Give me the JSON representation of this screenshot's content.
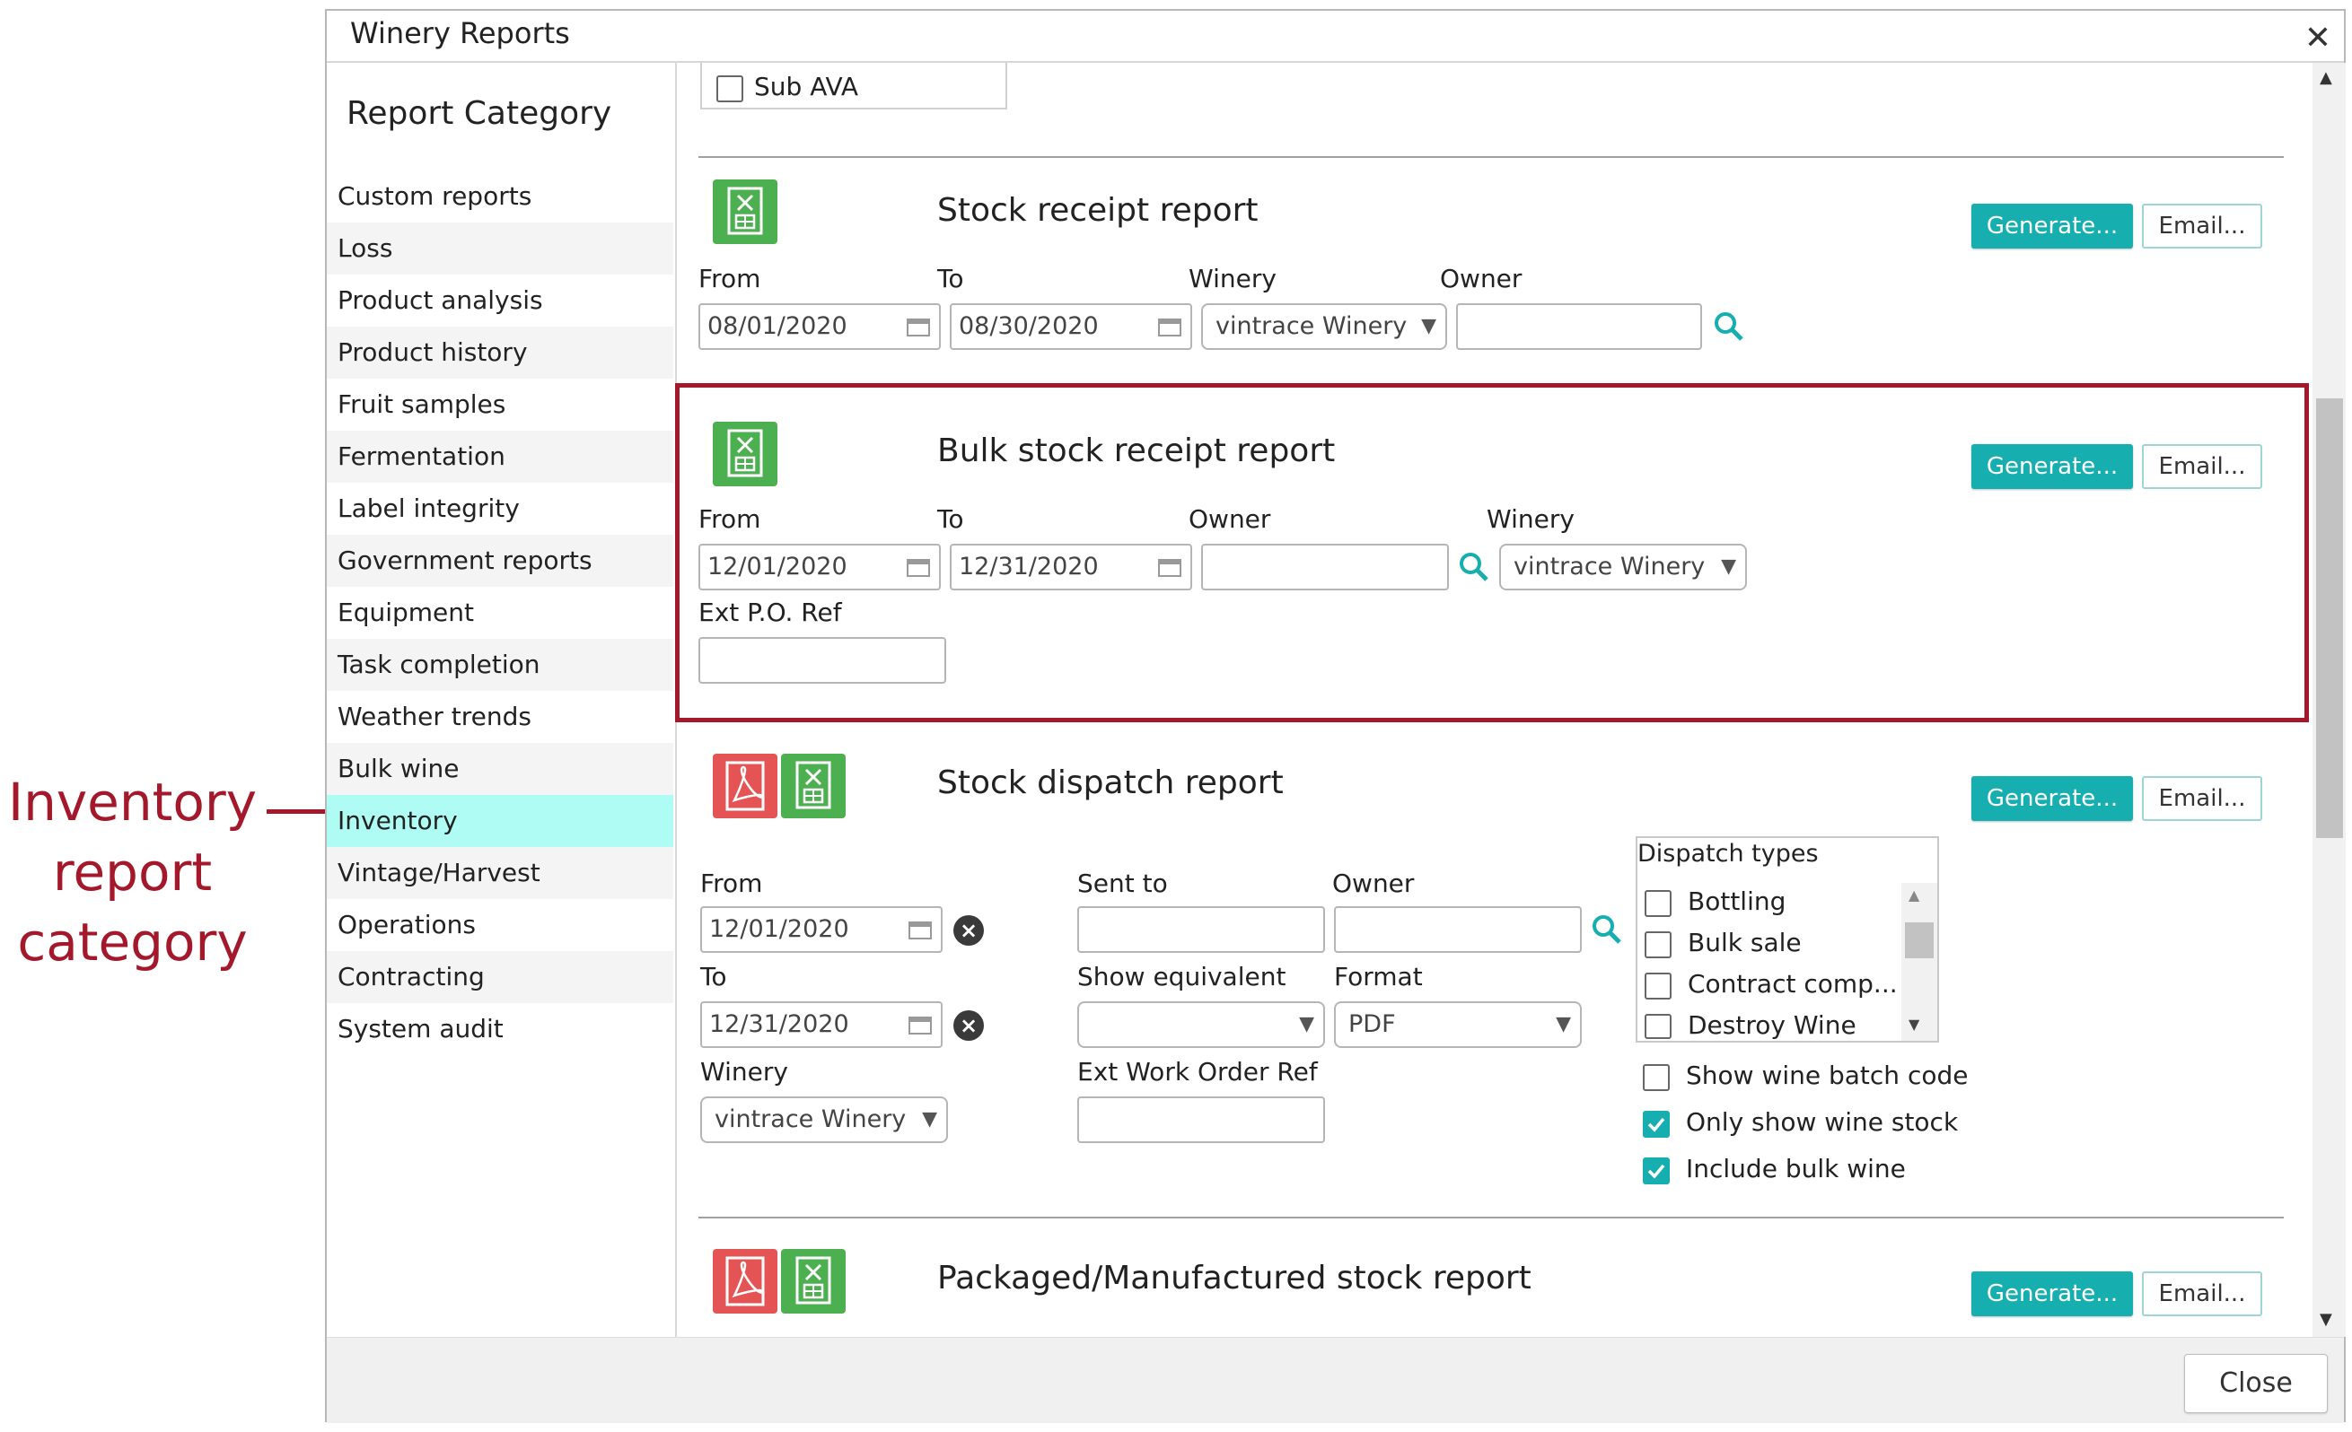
{
  "annotation": {
    "text": "Inventory report category",
    "lines": [
      "Inventory",
      "report",
      "category"
    ]
  },
  "dialog": {
    "title": "Winery Reports",
    "close_label": "Close"
  },
  "sidebar": {
    "heading": "Report Category",
    "items": [
      "Custom reports",
      "Loss",
      "Product analysis",
      "Product history",
      "Fruit samples",
      "Fermentation",
      "Label integrity",
      "Government reports",
      "Equipment",
      "Task completion",
      "Weather trends",
      "Bulk wine",
      "Inventory",
      "Vintage/Harvest",
      "Operations",
      "Contracting",
      "System audit"
    ],
    "selected": "Inventory"
  },
  "top_checkbox": {
    "label": "Sub AVA",
    "checked": false
  },
  "buttons": {
    "generate": "Generate...",
    "email": "Email..."
  },
  "reports": {
    "stock_receipt": {
      "title": "Stock receipt report",
      "labels": {
        "from": "From",
        "to": "To",
        "winery": "Winery",
        "owner": "Owner"
      },
      "from": "08/01/2020",
      "to": "08/30/2020",
      "winery": "vintrace Winery",
      "owner": ""
    },
    "bulk_stock_receipt": {
      "title": "Bulk stock receipt report",
      "labels": {
        "from": "From",
        "to": "To",
        "owner": "Owner",
        "winery": "Winery",
        "ext_po": "Ext P.O. Ref"
      },
      "from": "12/01/2020",
      "to": "12/31/2020",
      "owner": "",
      "winery": "vintrace Winery",
      "ext_po": ""
    },
    "stock_dispatch": {
      "title": "Stock dispatch report",
      "labels": {
        "from": "From",
        "to": "To",
        "sent_to": "Sent to",
        "owner": "Owner",
        "show_equivalent": "Show equivalent",
        "format": "Format",
        "winery": "Winery",
        "ext_work_order": "Ext Work Order Ref",
        "dispatch_types": "Dispatch types"
      },
      "from": "12/01/2020",
      "to": "12/31/2020",
      "sent_to": "",
      "owner": "",
      "show_equivalent": "",
      "format": "PDF",
      "winery": "vintrace Winery",
      "ext_work_order": "",
      "dispatch_types": [
        "Bottling",
        "Bulk sale",
        "Contract comp...",
        "Destroy Wine"
      ],
      "options": [
        {
          "label": "Show wine batch code",
          "checked": false
        },
        {
          "label": "Only show wine stock",
          "checked": true
        },
        {
          "label": "Include bulk wine",
          "checked": true
        }
      ]
    },
    "packaged": {
      "title": "Packaged/Manufactured stock report"
    }
  },
  "colors": {
    "accent": "#17aeb0",
    "highlight": "#a3192b",
    "selected_row": "#aefcf3",
    "excel_icon": "#4caf50",
    "pdf_icon": "#e45454"
  },
  "icons": [
    "excel-icon",
    "pdf-icon",
    "calendar-icon",
    "search-icon",
    "clear-icon",
    "dropdown-caret-icon",
    "close-icon",
    "scroll-up-icon",
    "scroll-down-icon"
  ]
}
